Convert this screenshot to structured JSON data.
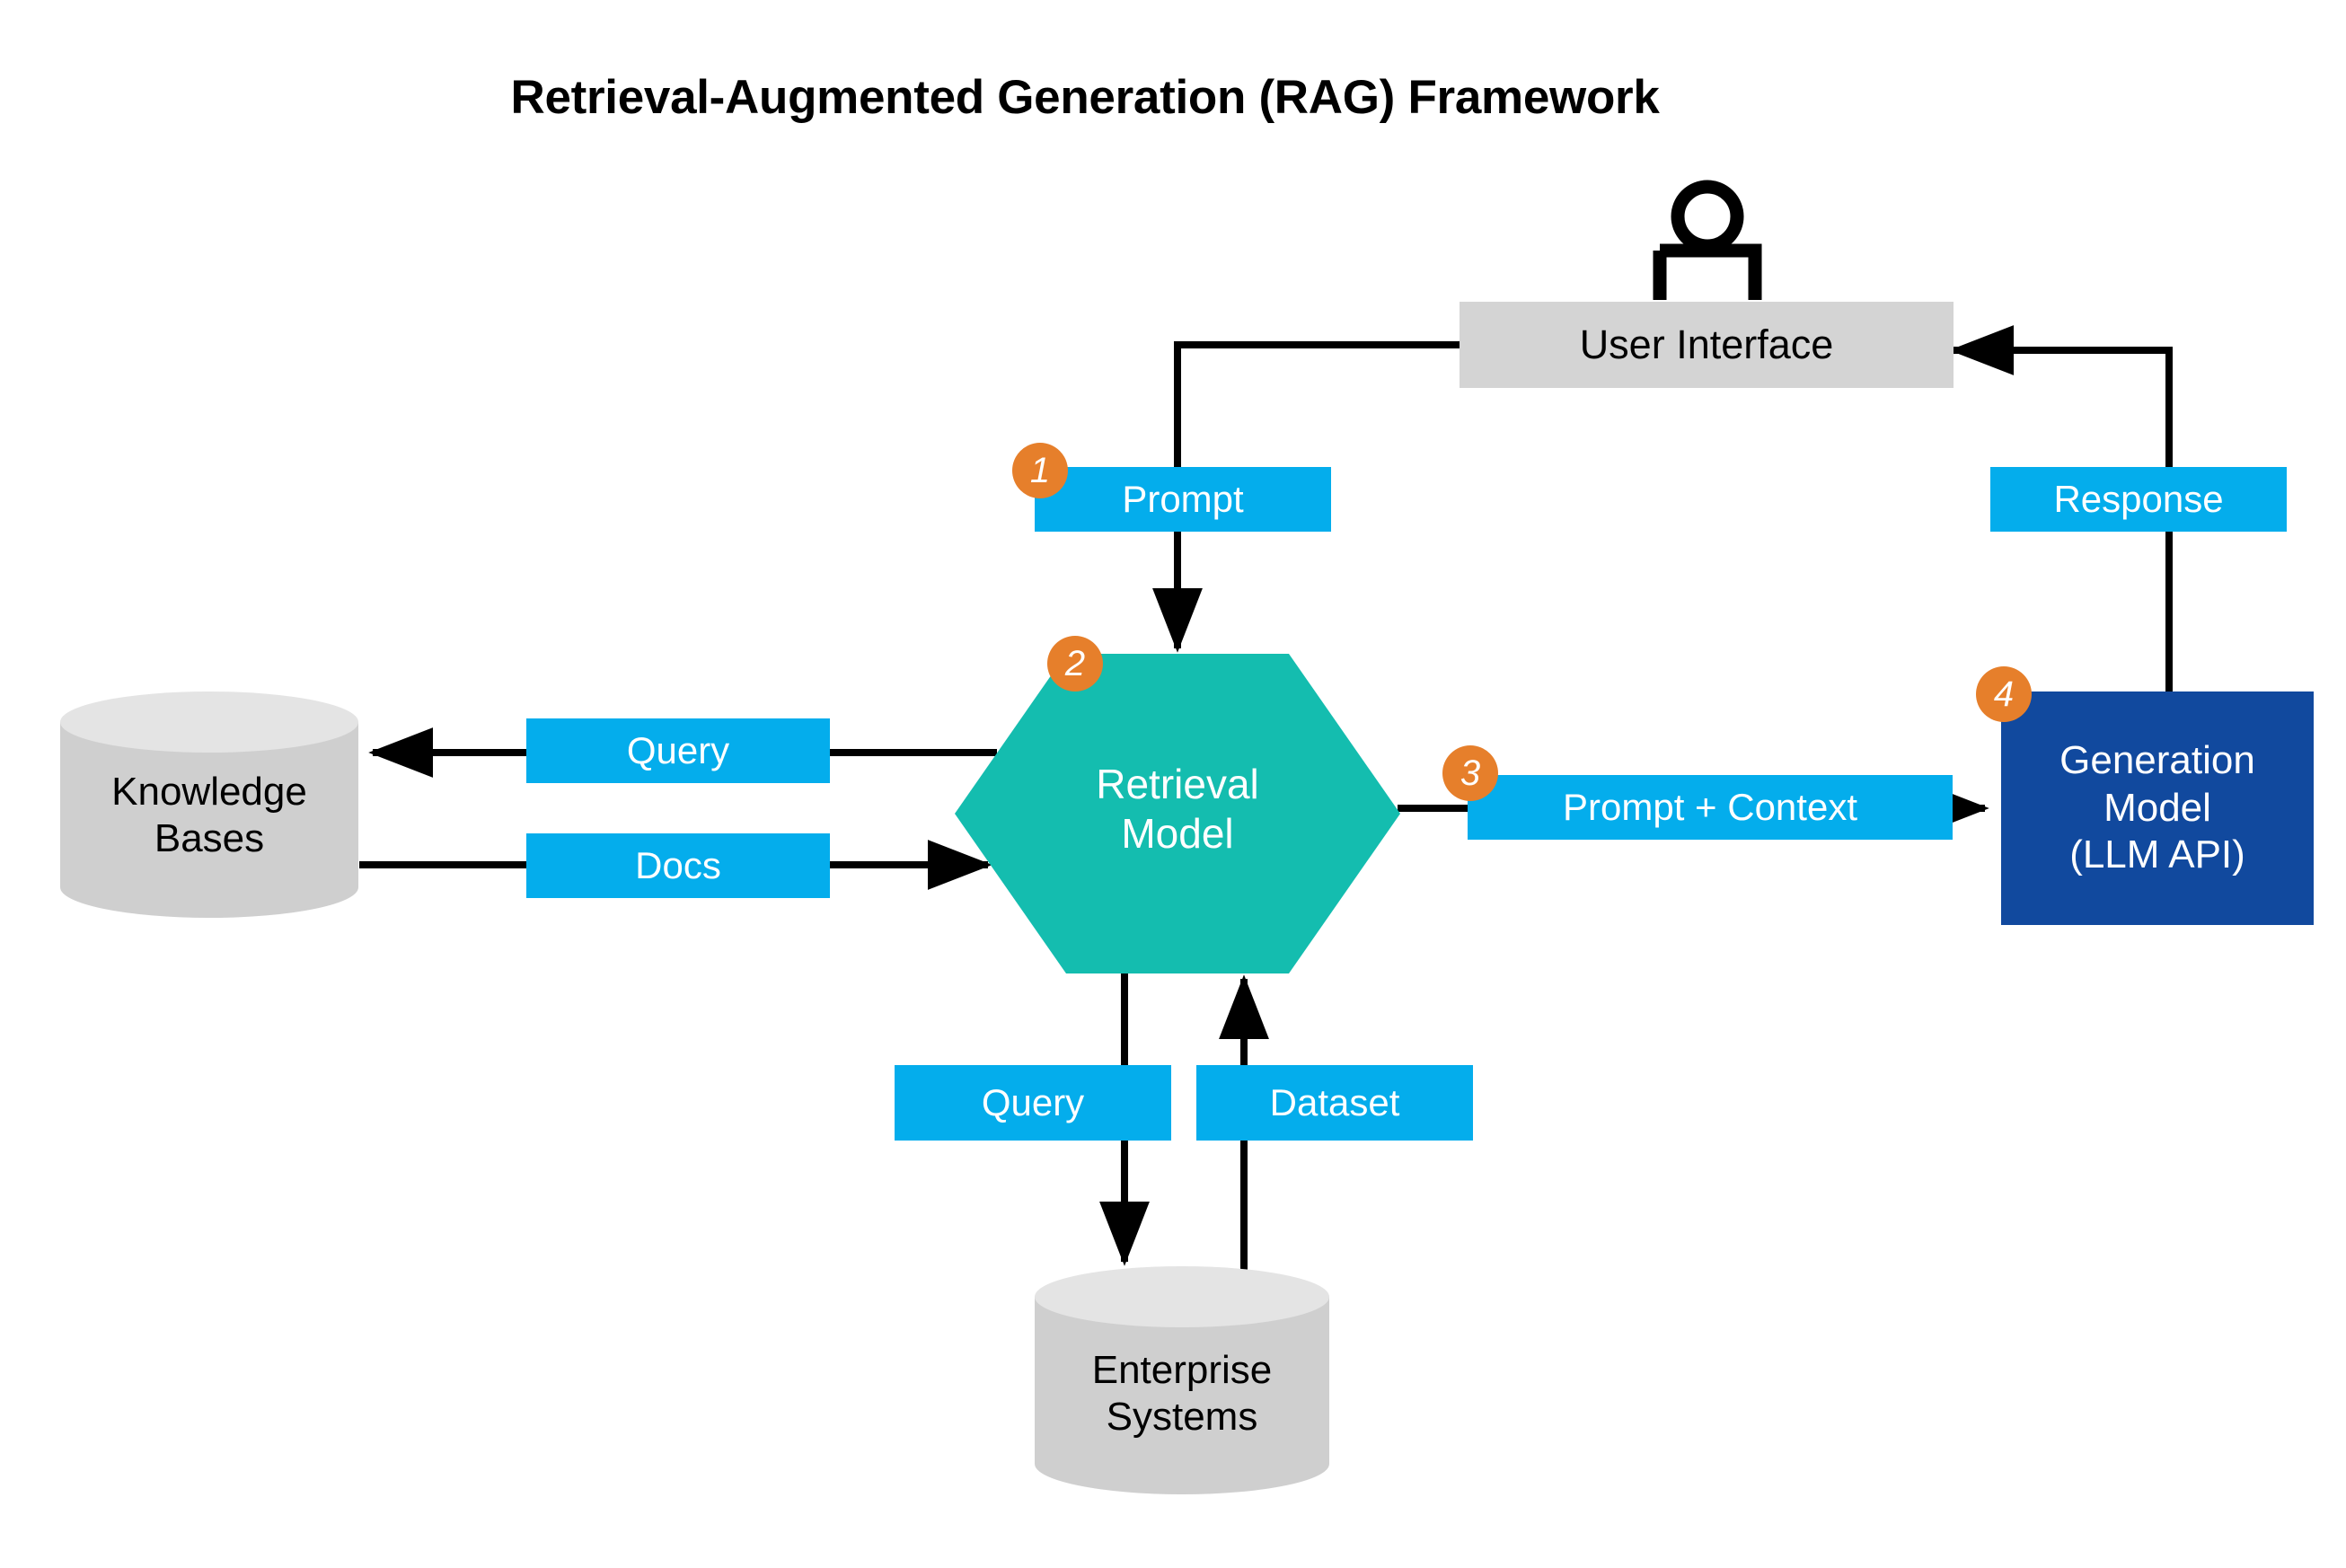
{
  "title": "Retrieval-Augmented Generation (RAG) Framework",
  "colors": {
    "flow_label_blue": "#04ADEC",
    "hexagon_teal": "#14BDAF",
    "generation_dark_blue": "#11499E",
    "ui_gray": "#d4d4d4",
    "cylinder_gray": "#cfcfcf",
    "cylinder_top_gray": "#e2e2e2",
    "badge_orange": "#E67F2B",
    "line_black": "#000000"
  },
  "nodes": {
    "user_interface": {
      "label": "User Interface"
    },
    "retrieval_model": {
      "line1": "Retrieval",
      "line2": "Model"
    },
    "generation_model": {
      "line1": "Generation",
      "line2": "Model",
      "line3": "(LLM API)"
    },
    "knowledge_bases": {
      "line1": "Knowledge",
      "line2": "Bases"
    },
    "enterprise_systems": {
      "line1": "Enterprise",
      "line2": "Systems"
    }
  },
  "flow_labels": {
    "prompt": "Prompt",
    "response": "Response",
    "query_kb": "Query",
    "docs": "Docs",
    "prompt_context": "Prompt + Context",
    "query_es": "Query",
    "dataset": "Dataset"
  },
  "badges": {
    "step1": "1",
    "step2": "2",
    "step3": "3",
    "step4": "4"
  },
  "icons": {
    "user": "user-actor-icon"
  }
}
